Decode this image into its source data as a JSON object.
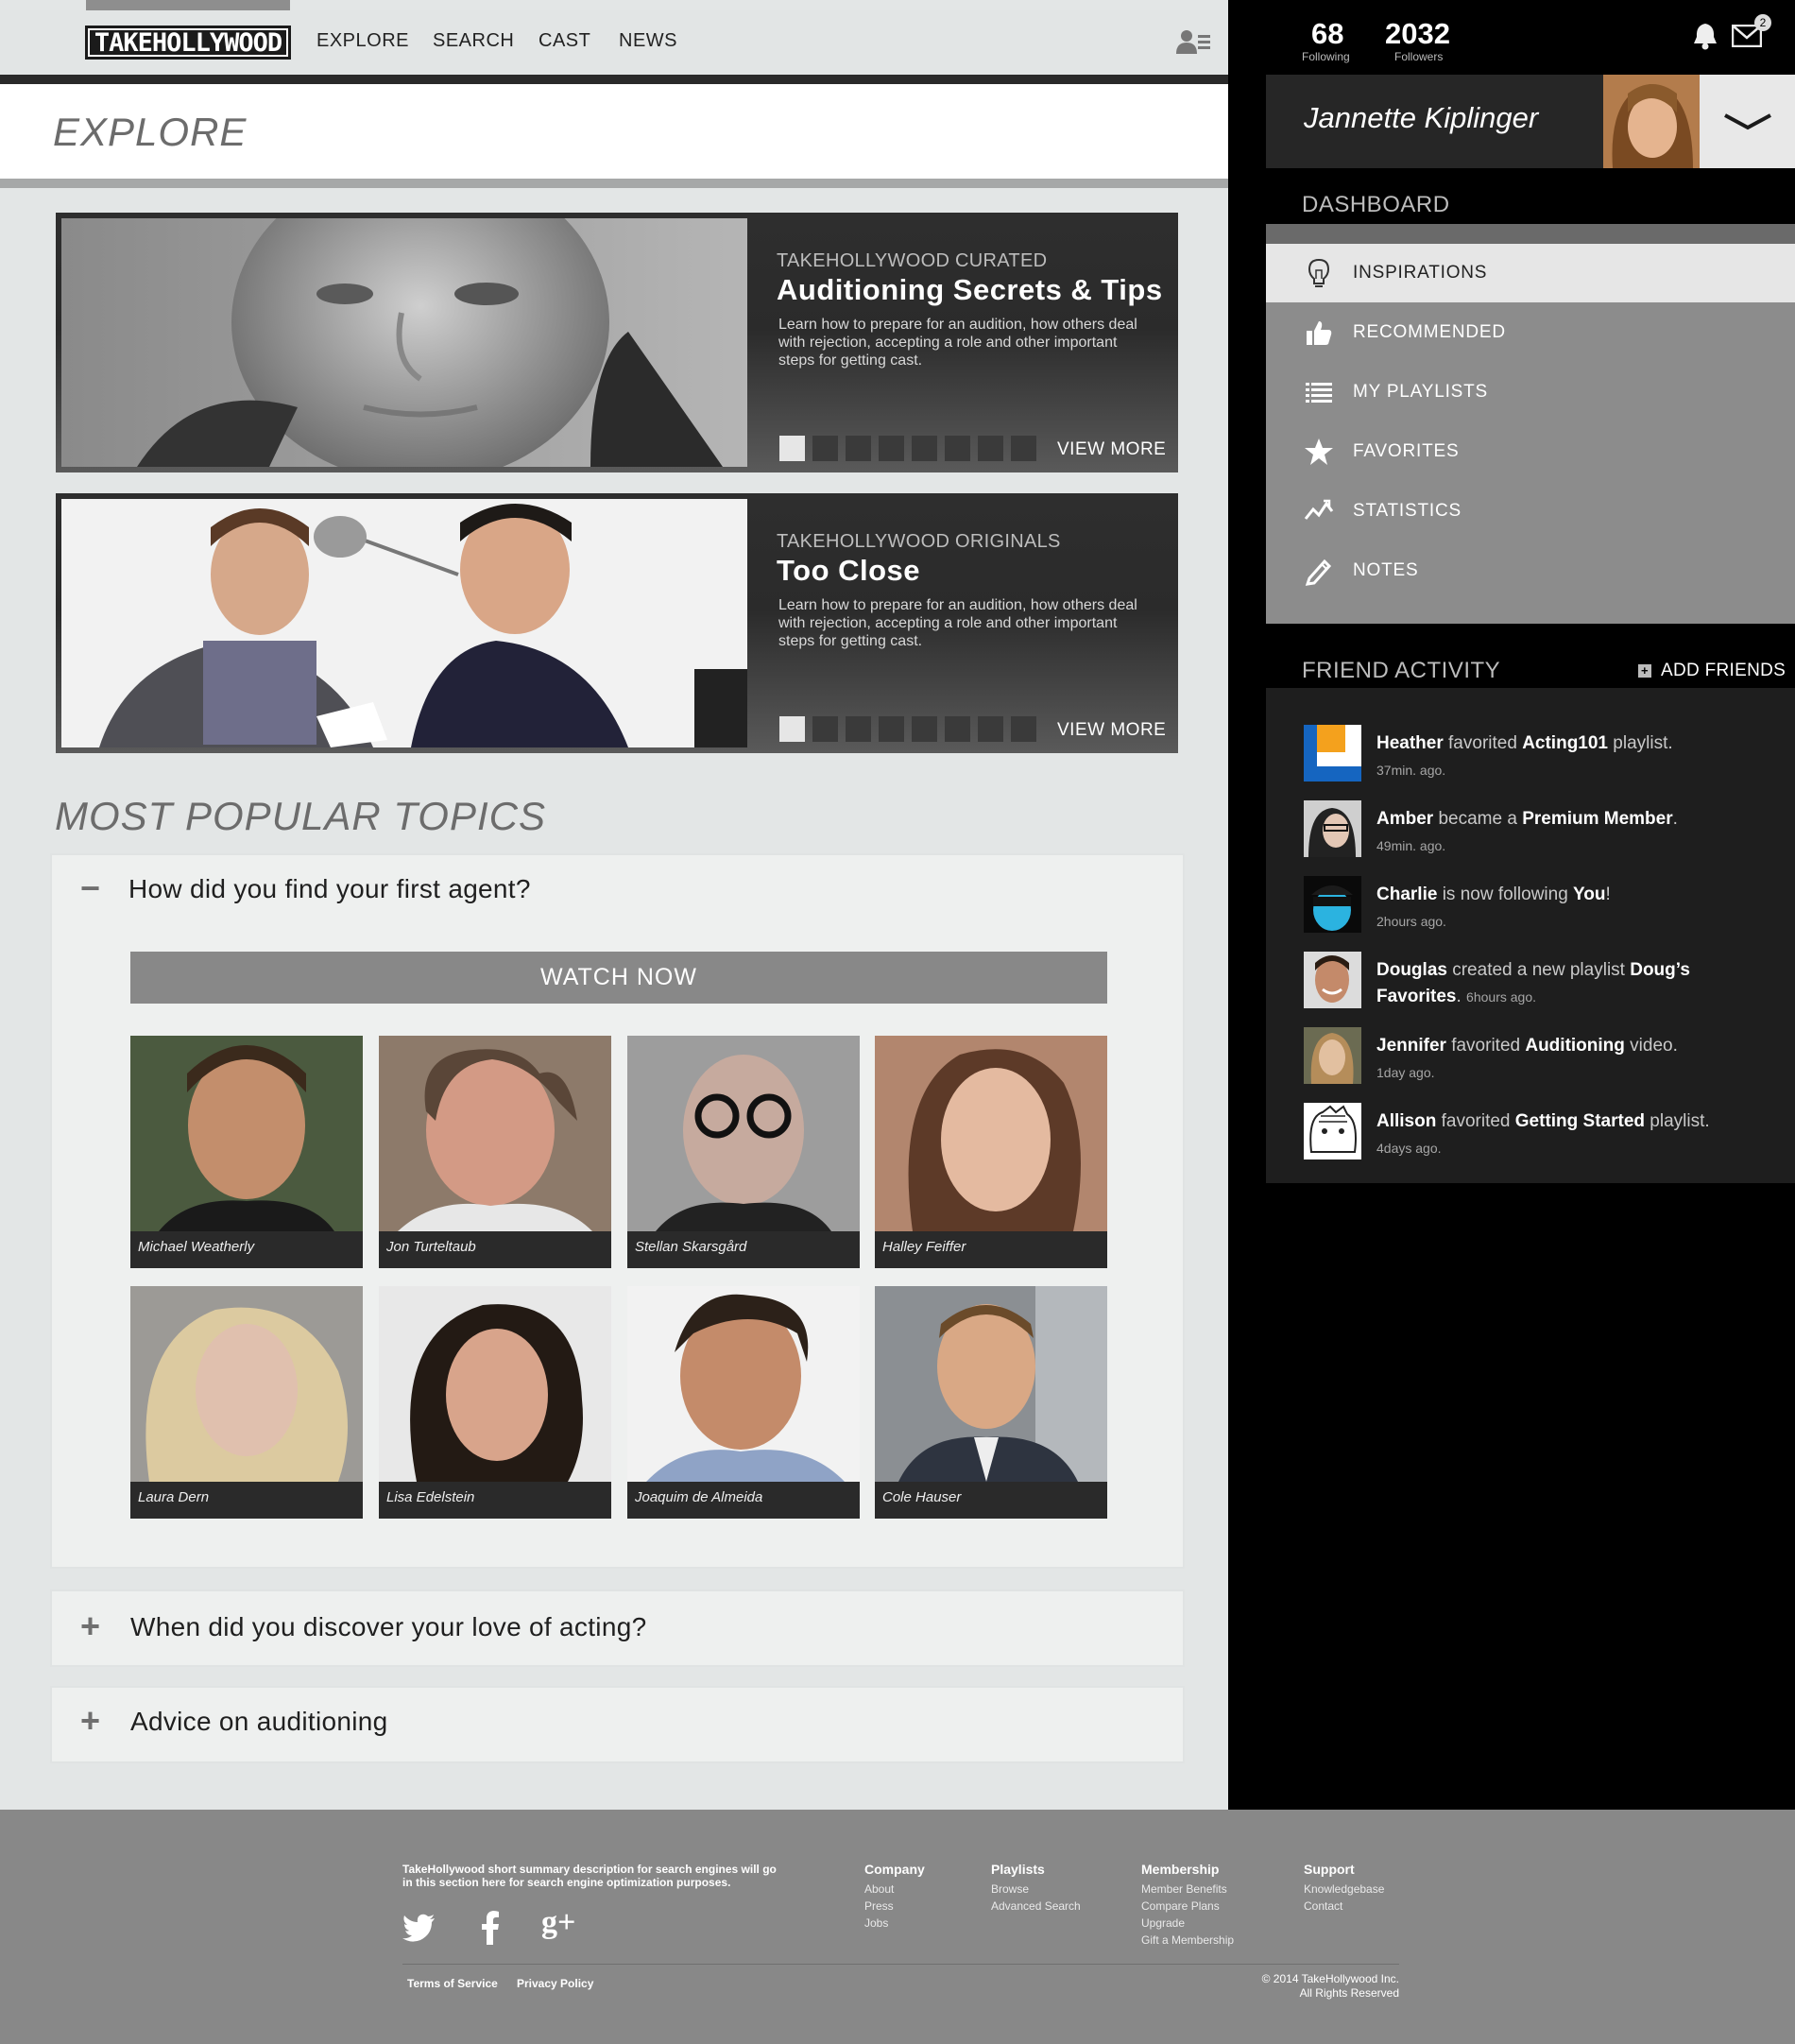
{
  "nav": {
    "logo": "TAKEHOLLYWOOD",
    "links": [
      "EXPLORE",
      "SEARCH",
      "CAST",
      "NEWS"
    ]
  },
  "page_title": "EXPLORE",
  "features": [
    {
      "eyebrow": "TAKEHOLLYWOOD CURATED",
      "title": "Auditioning Secrets & Tips",
      "desc": "Learn how to prepare for an audition, how others deal with rejection, accepting a role and other important steps for getting cast.",
      "more": "VIEW MORE"
    },
    {
      "eyebrow": "TAKEHOLLYWOOD ORIGINALS",
      "title": "Too Close",
      "desc": "Learn how to prepare for an audition, how others deal with rejection, accepting a role and other important steps for getting cast.",
      "more": "VIEW MORE"
    }
  ],
  "popular": {
    "title": "MOST POPULAR TOPICS",
    "topics": [
      {
        "question": "How did you find your first agent?",
        "toggle": "−"
      },
      {
        "question": "When did you discover your love of acting?",
        "toggle": "+"
      },
      {
        "question": "Advice on auditioning",
        "toggle": "+"
      }
    ],
    "watch_label": "WATCH NOW",
    "people": [
      "Michael Weatherly",
      "Jon Turteltaub",
      "Stellan Skarsgård",
      "Halley Feiffer",
      "Laura Dern",
      "Lisa Edelstein",
      "Joaquim de Almeida",
      "Cole Hauser"
    ]
  },
  "sidebar": {
    "following_count": "68",
    "following_label": "Following",
    "followers_count": "2032",
    "followers_label": "Followers",
    "mail_badge": "2",
    "user_name": "Jannette Kiplinger",
    "dashboard_title": "DASHBOARD",
    "dashboard_items": [
      {
        "label": "INSPIRATIONS",
        "icon": "lightbulb-icon"
      },
      {
        "label": "RECOMMENDED",
        "icon": "thumbs-up-icon"
      },
      {
        "label": "MY PLAYLISTS",
        "icon": "list-icon"
      },
      {
        "label": "FAVORITES",
        "icon": "star-icon"
      },
      {
        "label": "STATISTICS",
        "icon": "chart-icon"
      },
      {
        "label": "NOTES",
        "icon": "pencil-icon"
      }
    ],
    "friend_activity_title": "FRIEND ACTIVITY",
    "add_friends": "ADD FRIENDS",
    "activity": [
      {
        "name": "Heather",
        "action": " favorited ",
        "target": "Acting101",
        "suffix": " playlist.",
        "time": "37min. ago."
      },
      {
        "name": "Amber",
        "action": " became a ",
        "target": "Premium Member",
        "suffix": ".",
        "time": "49min. ago."
      },
      {
        "name": "Charlie",
        "action": " is now following ",
        "target": "You",
        "suffix": "!",
        "time": "2hours ago."
      },
      {
        "name": "Douglas",
        "action": " created a new playlist ",
        "target": "Doug’s Favorites",
        "suffix": ".",
        "time": "6hours ago."
      },
      {
        "name": "Jennifer",
        "action": " favorited ",
        "target": "Auditioning",
        "suffix": " video.",
        "time": "1day ago."
      },
      {
        "name": "Allison",
        "action": " favorited ",
        "target": "Getting Started",
        "suffix": " playlist.",
        "time": "4days ago."
      }
    ]
  },
  "footer": {
    "description": "TakeHollywood short summary description for  search engines will go in this section here for search engine optimization purposes.",
    "columns": [
      {
        "heading": "Company",
        "links": [
          "About",
          "Press",
          "Jobs"
        ]
      },
      {
        "heading": "Playlists",
        "links": [
          "Browse",
          "Advanced Search"
        ]
      },
      {
        "heading": "Membership",
        "links": [
          "Member Benefits",
          "Compare Plans",
          "Upgrade",
          "Gift a Membership"
        ]
      },
      {
        "heading": "Support",
        "links": [
          "Knowledgebase",
          "Contact"
        ]
      }
    ],
    "terms": "Terms of Service",
    "privacy": "Privacy Policy",
    "copyright": "© 2014 TakeHollywood Inc.",
    "rights": "All Rights Reserved"
  }
}
